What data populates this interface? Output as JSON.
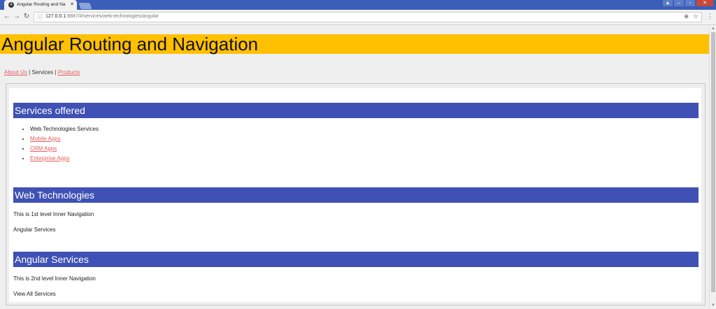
{
  "browser": {
    "tab_title": "Angular Routing and Na",
    "tab_favicon": "angular-icon",
    "url_host": "127.0.0.1",
    "url_rest": ":8887/#/services/web-technologies/angular"
  },
  "page": {
    "app_title": "Angular Routing and Navigation",
    "nav": {
      "about": "About Us",
      "sep1": "|",
      "services": "Services",
      "sep2": "|",
      "products": "Products"
    },
    "services_section": {
      "heading": "Services offered",
      "items": [
        {
          "label": "Web Technologies Services",
          "link": false
        },
        {
          "label": "Mobile Apps",
          "link": true
        },
        {
          "label": "CRM Apps",
          "link": true
        },
        {
          "label": "Enterprise Apps",
          "link": true
        }
      ]
    },
    "web_section": {
      "heading": "Web Technologies",
      "text": "This is 1st level Inner Navigation",
      "link_text": "Angular Services"
    },
    "angular_section": {
      "heading": "Angular Services",
      "text": "This is 2nd level Inner Navigation",
      "link_text": "View All Services"
    }
  },
  "colors": {
    "title_bg": "#ffc000",
    "section_bg": "#3f51b5",
    "link": "#e85c5c"
  }
}
